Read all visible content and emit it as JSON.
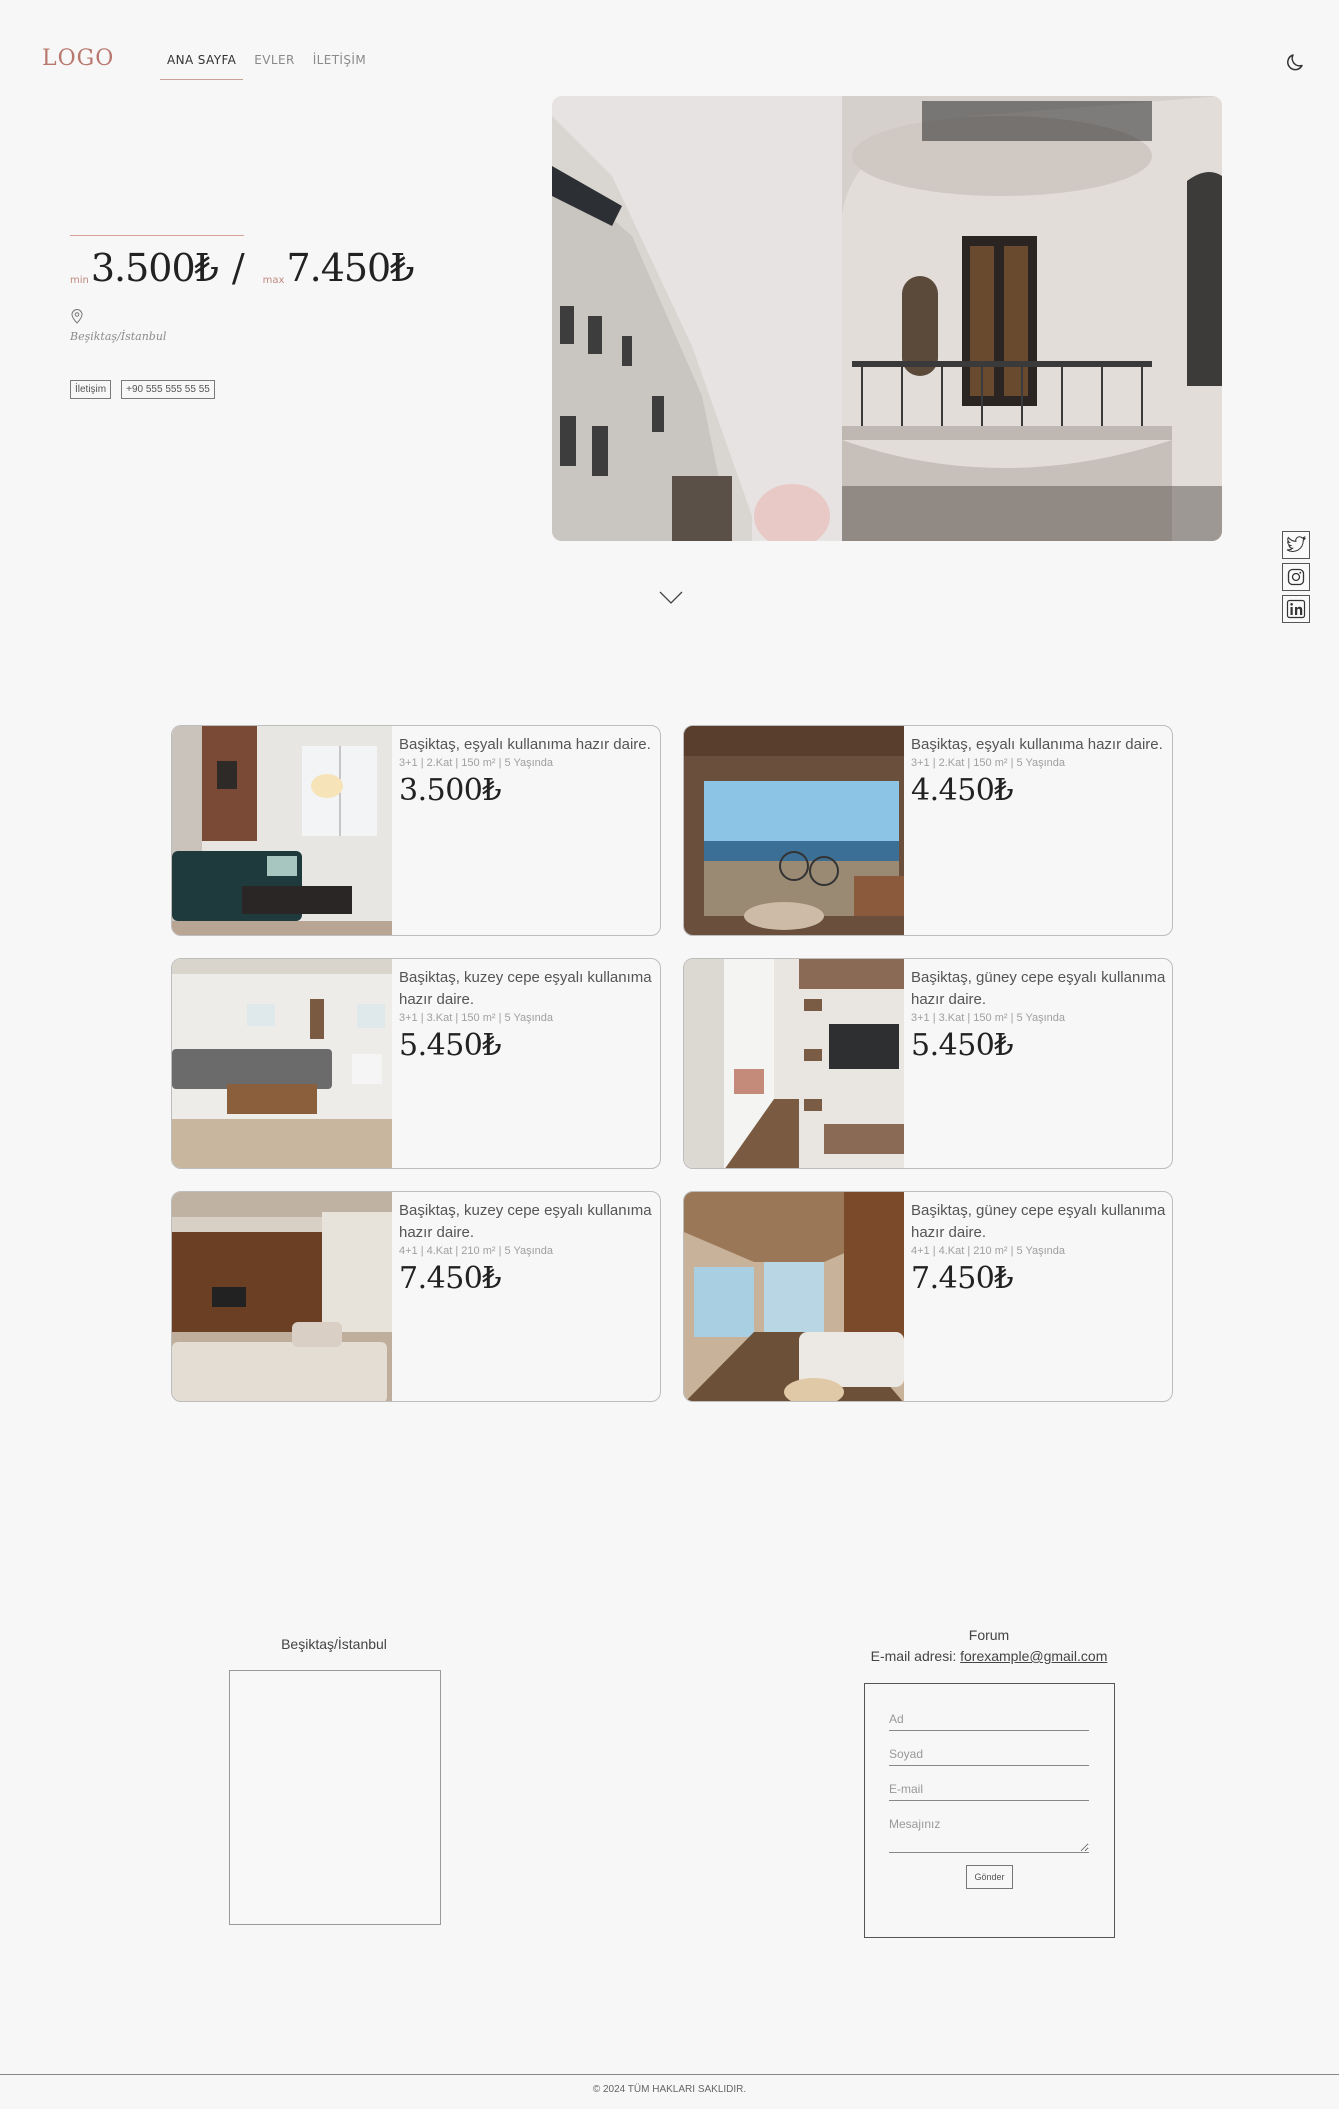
{
  "header": {
    "logo": "LOGO",
    "nav": [
      "ANA SAYFA",
      "EVLER",
      "İLETİŞİM"
    ],
    "active_nav": "ANA SAYFA",
    "theme_icon": "moon-icon"
  },
  "hero": {
    "min_label": "min",
    "min_price": "3.500₺",
    "separator": "/",
    "max_label": "max",
    "max_price": "7.450₺",
    "location": "Beşiktaş/İstanbul",
    "contact_button": "İletişim",
    "phone_button": "+90 555 555 55 55",
    "image": "street-building-balcony-photo",
    "scroll_icon": "chevron-down-icon"
  },
  "social": [
    "twitter-icon",
    "instagram-icon",
    "linkedin-icon"
  ],
  "listings": [
    {
      "title": "Başiktaş, eşyalı kullanıma hazır daire.",
      "specs": "3+1 | 2.Kat | 150 m² | 5 Yaşında",
      "price": "3.500₺",
      "image": "living-room-brick-wall"
    },
    {
      "title": "Başiktaş, eşyalı kullanıma hazır daire.",
      "specs": "3+1 | 2.Kat | 150 m² | 5 Yaşında",
      "price": "4.450₺",
      "image": "terrace-sea-view"
    },
    {
      "title": "Başiktaş, kuzey cepe eşyalı kullanıma hazır daire.",
      "specs": "3+1 | 3.Kat | 150 m² | 5 Yaşında",
      "price": "5.450₺",
      "image": "bright-living-room"
    },
    {
      "title": "Başiktaş, güney cepe eşyalı kullanıma hazır daire.",
      "specs": "3+1 | 3.Kat | 150 m² | 5 Yaşında",
      "price": "5.450₺",
      "image": "hallway-shelves-tv"
    },
    {
      "title": "Başiktaş, kuzey cepe eşyalı kullanıma hazır daire.",
      "specs": "4+1 | 4.Kat | 210 m² | 5 Yaşında",
      "price": "7.450₺",
      "image": "wood-panel-tv-room"
    },
    {
      "title": "Başiktaş, güney cepe eşyalı kullanıma hazır daire.",
      "specs": "4+1 | 4.Kat | 210 m² | 5 Yaşında",
      "price": "7.450₺",
      "image": "glass-wall-lake-room"
    }
  ],
  "contact": {
    "map_title": "Beşiktaş/İstanbul",
    "forum_title": "Forum",
    "email_label": "E-mail adresi:",
    "email": "forexample@gmail.com",
    "fields": [
      "Ad",
      "Soyad",
      "E-mail"
    ],
    "message_placeholder": "Mesajınız",
    "submit": "Gönder"
  },
  "footer": {
    "text": "© 2024 TÜM HAKLARI SAKLIDIR."
  },
  "colors": {
    "accent": "#b8786e",
    "background": "#f7f7f7",
    "text": "#3a3a3a"
  }
}
